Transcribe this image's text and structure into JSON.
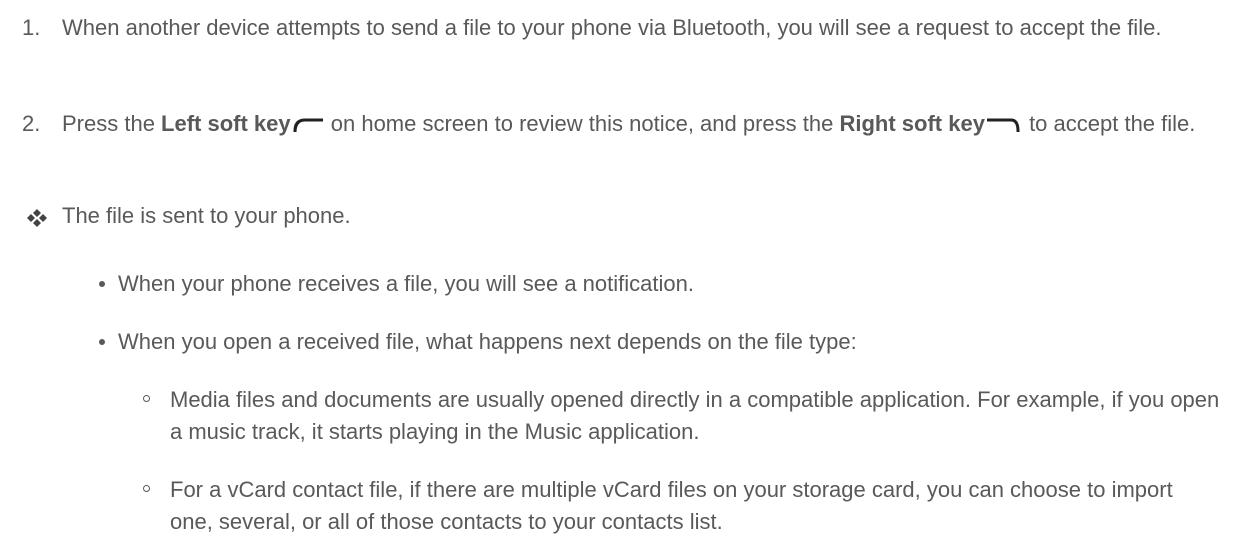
{
  "steps": [
    {
      "number": "1.",
      "text": "When another device attempts to send a file to your phone via Bluetooth, you will see a request to accept the file."
    },
    {
      "number": "2.",
      "part1": "Press the ",
      "bold1": "Left soft key",
      "part2": " on home screen to review this notice, and press the ",
      "bold2": "Right soft key",
      "part3": " to accept the file."
    }
  ],
  "result": {
    "icon": "four-diamond-bullet-icon",
    "text": "The file is sent to your phone."
  },
  "bullets": [
    "When your phone receives a file, you will see a notification.",
    "When you open a received file, what happens next depends on the file type:"
  ],
  "sub_bullets": [
    "Media files and documents are usually opened directly in a compatible application. For example, if you open a music track, it starts playing in the Music application.",
    "For a vCard contact file, if there are multiple vCard files on your storage card, you can choose to import one, several, or all of those contacts to your contacts list."
  ],
  "icons": {
    "left_soft_key": "left-soft-key-icon",
    "right_soft_key": "right-soft-key-icon"
  },
  "colors": {
    "text": "#58595b",
    "background": "#ffffff"
  }
}
